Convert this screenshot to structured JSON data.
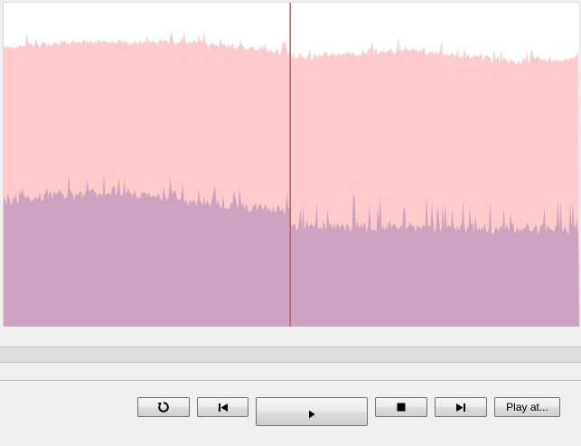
{
  "waveform": {
    "colors": {
      "upper": "#ffcacc",
      "lower": "#cca3bf",
      "background": "#ffffff",
      "cursor": "#c06060"
    },
    "cursor_position": 0.498
  },
  "controls": {
    "loop_icon": "loop-icon",
    "prev_icon": "skip-back-icon",
    "play_icon": "play-icon",
    "stop_icon": "stop-icon",
    "next_icon": "skip-forward-icon",
    "play_at_label": "Play at..."
  }
}
